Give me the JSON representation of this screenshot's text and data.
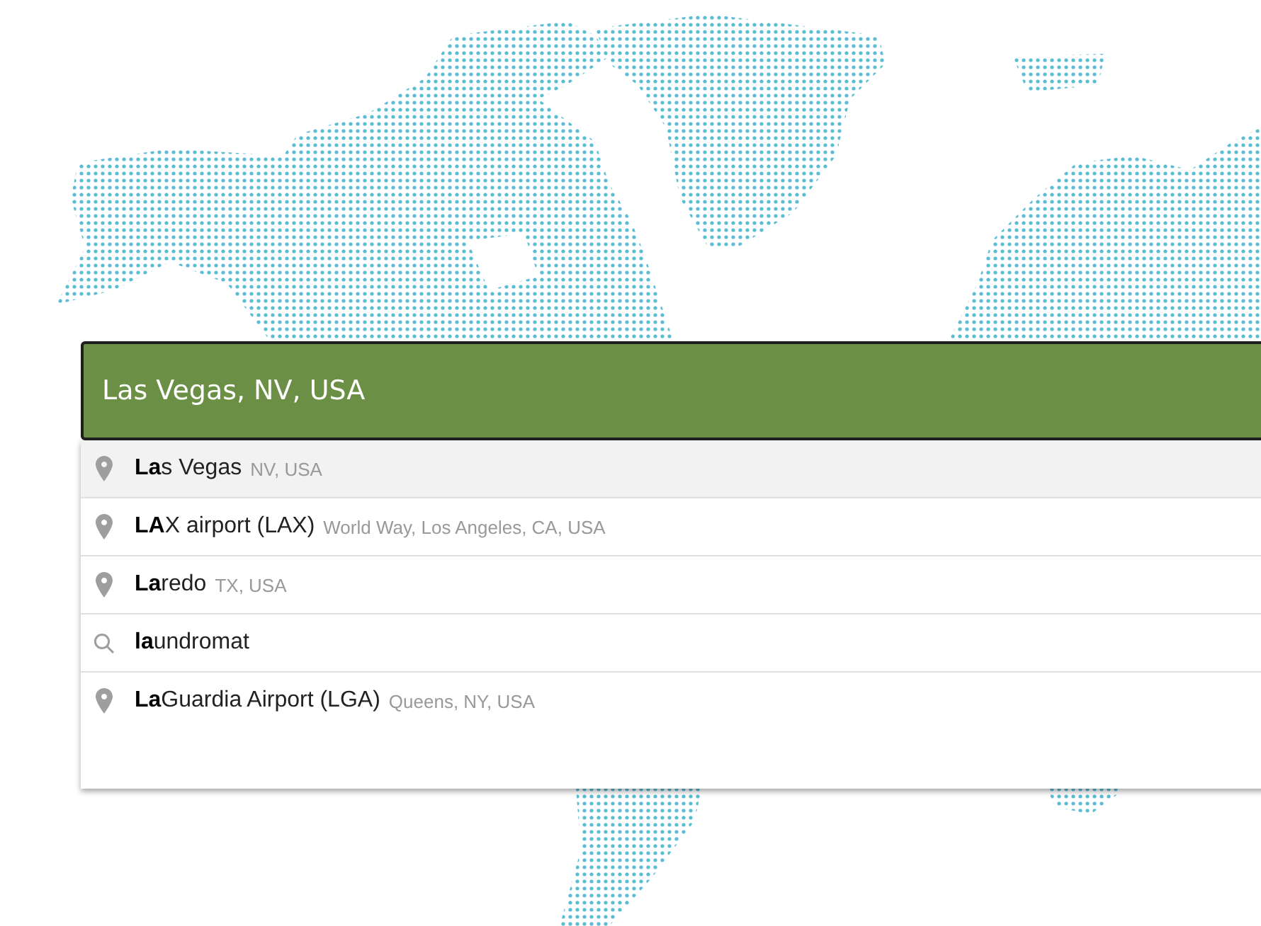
{
  "search": {
    "value": "Las Vegas, NV, USA"
  },
  "suggestions": [
    {
      "kind": "place",
      "main": "**La**s Vegas",
      "detail": "NV, USA",
      "selected": true
    },
    {
      "kind": "place",
      "main": "**LA**X airport (LAX)",
      "detail": "World Way, Los Angeles, CA, USA",
      "selected": false
    },
    {
      "kind": "place",
      "main": "**La**redo",
      "detail": "TX, USA",
      "selected": false
    },
    {
      "kind": "query",
      "main": "**la**undromat",
      "selected": false
    },
    {
      "kind": "place",
      "main": "**La**Guardia Airport (LGA)",
      "detail": "Queens, NY, USA",
      "selected": false
    }
  ]
}
